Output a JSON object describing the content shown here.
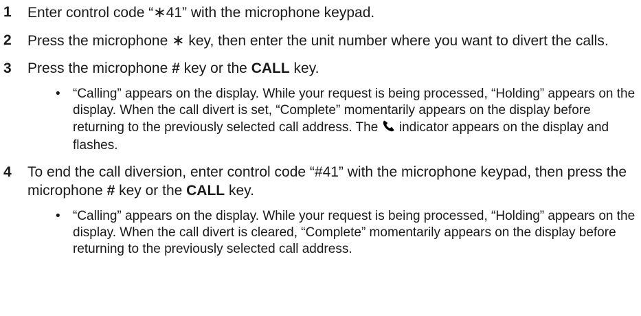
{
  "steps": [
    {
      "number": "1",
      "text_a": "Enter control code “",
      "star": "∗",
      "text_b": "41” with the microphone keypad."
    },
    {
      "number": "2",
      "text_a": "Press the microphone ",
      "star": "∗",
      "text_b": " key, then enter the unit number where you want to divert the calls."
    },
    {
      "number": "3",
      "text_a": "Press the microphone ",
      "hash": "#",
      "text_b": " key or the ",
      "call": "CALL",
      "text_c": " key.",
      "bullet": {
        "dot": "•",
        "text_a": "“Calling” appears on the display. While your request is being processed, “Holding” appears on the display. When the call divert is set, “Complete” momentarily appears on the display before returning to the previously selected call address. The ",
        "icon": "phone-handset-icon",
        "text_b": " indicator appears on the display and flashes."
      }
    },
    {
      "number": "4",
      "text_a": "To end the call diversion, enter control code “#41” with the microphone keypad, then press the microphone ",
      "hash": "#",
      "text_b": " key or the ",
      "call": "CALL",
      "text_c": " key.",
      "bullet": {
        "dot": "•",
        "text": "“Calling” appears on the display. While your request is being processed, “Holding” appears on the display. When the call divert is cleared, “Complete” momentarily appears on the display before returning to the previously selected call address."
      }
    }
  ]
}
